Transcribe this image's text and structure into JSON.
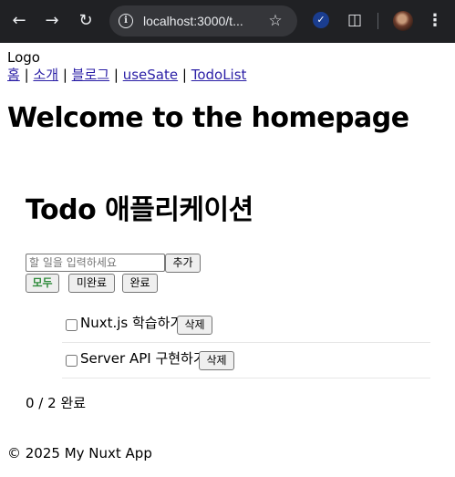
{
  "browser": {
    "url": "localhost:3000/t...",
    "icons": {
      "back": "back-arrow-icon",
      "forward": "forward-arrow-icon",
      "reload": "reload-icon",
      "site_info": "info-icon",
      "bookmark": "star-icon",
      "extension": "check-extension-icon",
      "extensions": "puzzle-icon",
      "profile": "avatar",
      "menu": "kebab-menu-icon"
    }
  },
  "header": {
    "logo": "Logo",
    "nav": [
      {
        "label": "홈"
      },
      {
        "label": "소개"
      },
      {
        "label": "블로그"
      },
      {
        "label": "useSate"
      },
      {
        "label": "TodoList"
      }
    ],
    "separator": "|"
  },
  "main": {
    "heading": "Welcome to the homepage"
  },
  "todo": {
    "title": "Todo 애플리케이션",
    "input_placeholder": "할 일을 입력하세요",
    "input_value": "",
    "add_label": "추가",
    "filters": [
      {
        "label": "모두",
        "active": true
      },
      {
        "label": "미완료",
        "active": false
      },
      {
        "label": "완료",
        "active": false
      }
    ],
    "items": [
      {
        "text": "Nuxt.js 학습하기",
        "done": false,
        "delete_label": "삭제"
      },
      {
        "text": "Server API 구현하기",
        "done": false,
        "delete_label": "삭제"
      }
    ],
    "summary": "0 / 2 완료"
  },
  "footer": {
    "text": "© 2025 My Nuxt App"
  },
  "colors": {
    "chrome_bg": "#202124",
    "omnibox_bg": "#35363a",
    "link": "#2b1fa6",
    "active_filter": "#2e8b3a"
  }
}
